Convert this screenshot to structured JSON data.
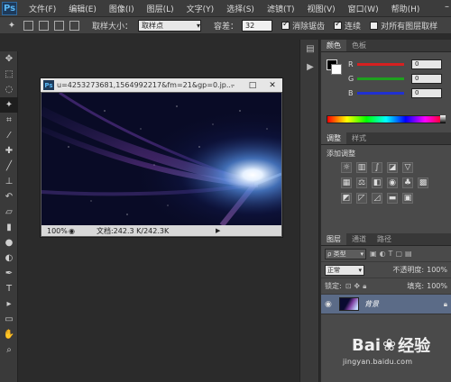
{
  "app": {
    "logo": "Ps",
    "menu": [
      "文件(F)",
      "编辑(E)",
      "图像(I)",
      "图层(L)",
      "文字(Y)",
      "选择(S)",
      "滤镜(T)",
      "视图(V)",
      "窗口(W)",
      "帮助(H)"
    ],
    "window_controls": [
      "–",
      "□",
      "✕"
    ]
  },
  "options_bar": {
    "sample_size_label": "取样大小：",
    "sample_size_value": "取样点",
    "tolerance_label": "容差：",
    "tolerance_value": "32",
    "antialias_label": "消除锯齿",
    "antialias_checked": true,
    "contiguous_label": "连续",
    "contiguous_checked": true,
    "all_layers_label": "对所有图层取样",
    "all_layers_checked": false
  },
  "tools": [
    "move-icon",
    "marquee-icon",
    "lasso-icon",
    "magic-wand-icon",
    "crop-icon",
    "eyedropper-icon",
    "healing-icon",
    "brush-icon",
    "stamp-icon",
    "history-brush-icon",
    "eraser-icon",
    "gradient-icon",
    "blur-icon",
    "dodge-icon",
    "pen-icon",
    "type-icon",
    "path-select-icon",
    "shape-icon",
    "hand-icon",
    "zoom-icon"
  ],
  "document": {
    "title": "u=4253273681,1564992217&fm=21&gp=0.jp...",
    "zoom": "100%",
    "info": "文档:242.3 K/242.3K"
  },
  "color_panel": {
    "tabs": [
      "颜色",
      "色板"
    ],
    "channels": [
      {
        "label": "R",
        "value": "0",
        "color": "#d62020"
      },
      {
        "label": "G",
        "value": "0",
        "color": "#1fa01f"
      },
      {
        "label": "B",
        "value": "0",
        "color": "#2030d0"
      }
    ]
  },
  "adjustments_panel": {
    "tabs": [
      "调整",
      "样式"
    ],
    "title": "添加调整"
  },
  "layers_panel": {
    "tabs": [
      "图层",
      "通道",
      "路径"
    ],
    "kind_label": "ρ 类型",
    "blend_mode": "正常",
    "opacity_label": "不透明度:",
    "opacity_value": "100%",
    "lock_label": "锁定:",
    "fill_label": "填充:",
    "fill_value": "100%",
    "layer_name": "背景"
  },
  "watermark": {
    "logo_left": "Bai",
    "logo_right": "经验",
    "url": "jingyan.baidu.com"
  }
}
